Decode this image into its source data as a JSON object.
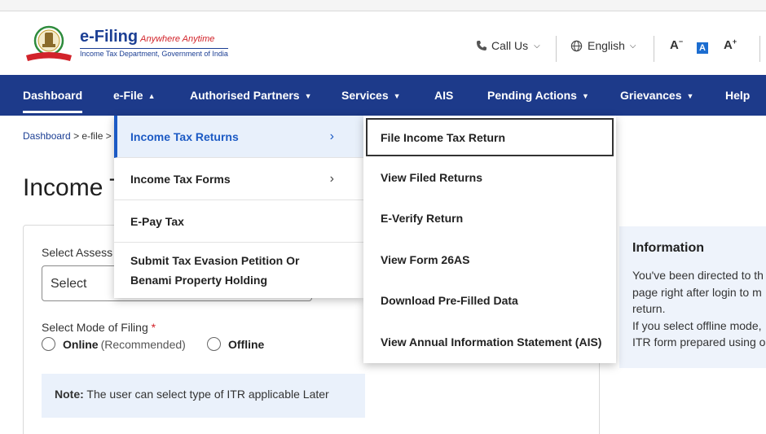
{
  "brand": {
    "title": "e-Filing",
    "tagline": "Anywhere Anytime",
    "subtitle": "Income Tax Department, Government of India"
  },
  "header": {
    "call_us": "Call Us",
    "language": "English",
    "font_decrease": "A",
    "font_normal": "A",
    "font_increase": "A"
  },
  "nav": {
    "items": [
      "Dashboard",
      "e-File",
      "Authorised Partners",
      "Services",
      "AIS",
      "Pending Actions",
      "Grievances",
      "Help"
    ]
  },
  "breadcrumb": {
    "home": "Dashboard",
    "current": "e-file"
  },
  "page": {
    "title": "Income T"
  },
  "form": {
    "assessment_label": "Select Assess",
    "assessment_select": "Select",
    "mode_label": "Select Mode of Filing",
    "required_mark": "*",
    "online": "Online",
    "online_note": "(Recommended)",
    "offline": "Offline",
    "note_label": "Note:",
    "note_text": "The user can select type of ITR applicable Later"
  },
  "info": {
    "title": "Information",
    "lines": [
      "You've been directed to th",
      "page right after login to m",
      "return.",
      "If you select offline mode,",
      "ITR form prepared using o"
    ]
  },
  "efile_menu": {
    "items": [
      "Income Tax Returns",
      "Income Tax Forms",
      "E-Pay Tax",
      "Submit Tax Evasion Petition Or Benami Property Holding"
    ]
  },
  "itr_submenu": {
    "items": [
      "File Income Tax Return",
      "View Filed Returns",
      "E-Verify Return",
      "View Form 26AS",
      "Download Pre-Filled Data",
      "View Annual Information Statement (AIS)"
    ]
  },
  "colors": {
    "nav_bg": "#1d3a8a",
    "accent": "#1c5ac4",
    "required": "#d2232a",
    "note_bg": "#eaf1fb"
  }
}
